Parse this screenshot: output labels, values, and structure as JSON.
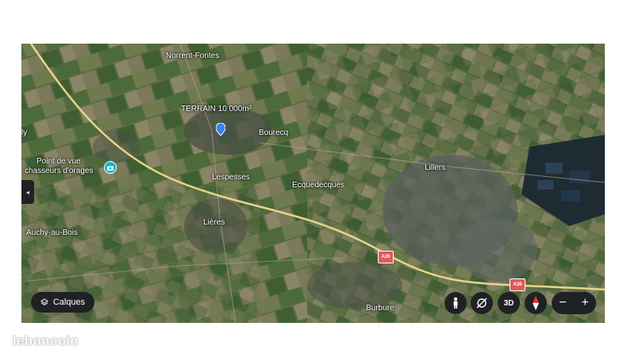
{
  "map": {
    "places": {
      "norrent_fontes": "Norrent-Fontes",
      "terrain": "TERRAIN 10 000m²",
      "bourecq": "Bourecq",
      "point_de_vue": "Point de vue",
      "chasseurs_orages": "chasseurs d'orages",
      "lespesses": "Lespesses",
      "ecquedecques": "Ecquedecques",
      "lillers": "Lillers",
      "lieres": "Lières",
      "auchy_au_bois": "Auchy-au-Bois",
      "burbure": "Burbure",
      "edge_fragment": "ly"
    },
    "roads": {
      "a26_label_1": "A26",
      "a26_label_2": "A26"
    }
  },
  "controls": {
    "layers_label": "Calques",
    "view_3d_label": "3D",
    "zoom_out": "−",
    "zoom_in": "+",
    "sidebar_toggle": "◂"
  },
  "watermark": "leboncoin",
  "icons": {
    "pin": "location-pin-icon",
    "poi": "camera-poi-icon",
    "layers": "layers-icon",
    "pegman": "street-view-pegman-icon",
    "rotate": "rotate-view-icon",
    "compass": "compass-icon"
  },
  "colors": {
    "pin": "#3b82f6",
    "poi": "#12b5cb",
    "road_shield": "#e05a5a",
    "controls": "#202124"
  }
}
